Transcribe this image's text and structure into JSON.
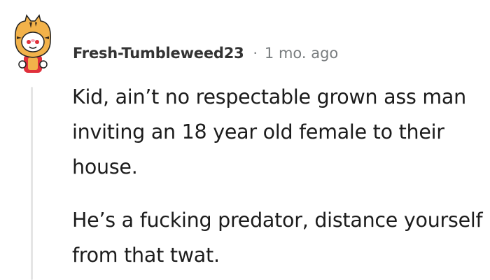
{
  "comment": {
    "author": "Fresh-Tumbleweed23",
    "separator": "·",
    "timestamp": "1 mo. ago",
    "paragraphs": [
      "Kid, ain’t no respectable grown ass man inviting an 18 year old female to their house.",
      "He’s a fucking predator, distance yourself from that twat."
    ]
  },
  "colors": {
    "author": "#333333",
    "meta": "#787c7e",
    "body_text": "#1c1c1c",
    "thread_line": "#e5e5e5",
    "avatar_primary": "#f2b24a",
    "avatar_accent": "#e0303b"
  },
  "icons": {
    "avatar": "snoo-avatar-tiger-costume"
  }
}
